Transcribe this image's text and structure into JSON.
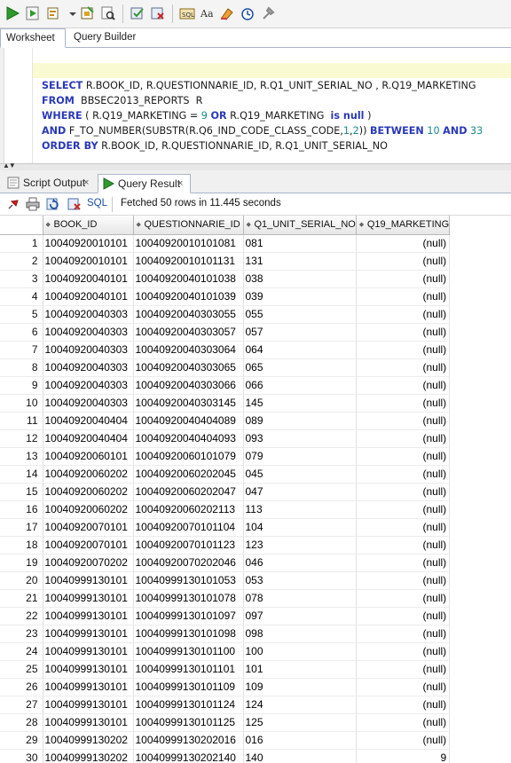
{
  "toolbar": {
    "icons": [
      "run-statement-icon",
      "run-script-icon",
      "explain-plan-icon",
      "dropdown-arrow-icon",
      "autotrace-icon",
      "sql-tuning-icon",
      "commit-icon",
      "rollback-icon",
      "unshared-sql-icon",
      "to-upper-lower-icon",
      "clear-icon",
      "sql-history-icon",
      "format-icon"
    ]
  },
  "editor": {
    "tabs": [
      "Worksheet",
      "Query Builder"
    ],
    "lines": [
      [
        {
          "t": "SELECT",
          "k": "kw"
        },
        {
          "t": " R.BOOK_ID, R.QUESTIONNARIE_ID, R.Q1_UNIT_SERIAL_NO , R.Q19_MARKETING"
        }
      ],
      [
        {
          "t": "FROM",
          "k": "kw"
        },
        {
          "t": "  BBSEC2013_REPORTS  R"
        }
      ],
      [
        {
          "t": "WHERE",
          "k": "kw"
        },
        {
          "t": " ( R.Q19_MARKETING = "
        },
        {
          "t": "9",
          "k": "num"
        },
        {
          "t": " "
        },
        {
          "t": "OR",
          "k": "kw"
        },
        {
          "t": " R.Q19_MARKETING  "
        },
        {
          "t": "is null",
          "k": "kw"
        },
        {
          "t": " )"
        }
      ],
      [
        {
          "t": "AND",
          "k": "kw"
        },
        {
          "t": " F_TO_NUMBER(SUBSTR(R.Q6_IND_CODE_CLASS_CODE,"
        },
        {
          "t": "1",
          "k": "num"
        },
        {
          "t": ","
        },
        {
          "t": "2",
          "k": "num"
        },
        {
          "t": ")) "
        },
        {
          "t": "BETWEEN",
          "k": "kw"
        },
        {
          "t": " "
        },
        {
          "t": "10",
          "k": "num"
        },
        {
          "t": " "
        },
        {
          "t": "AND",
          "k": "kw"
        },
        {
          "t": " "
        },
        {
          "t": "33",
          "k": "num"
        }
      ],
      [
        {
          "t": "ORDER BY",
          "k": "kw"
        },
        {
          "t": " R.BOOK_ID, R.QUESTIONNARIE_ID, R.Q1_UNIT_SERIAL_NO"
        }
      ]
    ]
  },
  "result_tabs": {
    "script_output": "Script Output",
    "query_result": "Query Result",
    "close_glyph": "×"
  },
  "result_toolbar": {
    "sql_label": "SQL",
    "status": "Fetched 50 rows in 11.445 seconds"
  },
  "grid": {
    "columns": [
      "BOOK_ID",
      "QUESTIONNARIE_ID",
      "Q1_UNIT_SERIAL_NO",
      "Q19_MARKETING"
    ],
    "rows": [
      [
        "1",
        "10040920010101",
        "10040920010101081",
        "081",
        "(null)"
      ],
      [
        "2",
        "10040920010101",
        "10040920010101131",
        "131",
        "(null)"
      ],
      [
        "3",
        "10040920040101",
        "10040920040101038",
        "038",
        "(null)"
      ],
      [
        "4",
        "10040920040101",
        "10040920040101039",
        "039",
        "(null)"
      ],
      [
        "5",
        "10040920040303",
        "10040920040303055",
        "055",
        "(null)"
      ],
      [
        "6",
        "10040920040303",
        "10040920040303057",
        "057",
        "(null)"
      ],
      [
        "7",
        "10040920040303",
        "10040920040303064",
        "064",
        "(null)"
      ],
      [
        "8",
        "10040920040303",
        "10040920040303065",
        "065",
        "(null)"
      ],
      [
        "9",
        "10040920040303",
        "10040920040303066",
        "066",
        "(null)"
      ],
      [
        "10",
        "10040920040303",
        "10040920040303145",
        "145",
        "(null)"
      ],
      [
        "11",
        "10040920040404",
        "10040920040404089",
        "089",
        "(null)"
      ],
      [
        "12",
        "10040920040404",
        "10040920040404093",
        "093",
        "(null)"
      ],
      [
        "13",
        "10040920060101",
        "10040920060101079",
        "079",
        "(null)"
      ],
      [
        "14",
        "10040920060202",
        "10040920060202045",
        "045",
        "(null)"
      ],
      [
        "15",
        "10040920060202",
        "10040920060202047",
        "047",
        "(null)"
      ],
      [
        "16",
        "10040920060202",
        "10040920060202113",
        "113",
        "(null)"
      ],
      [
        "17",
        "10040920070101",
        "10040920070101104",
        "104",
        "(null)"
      ],
      [
        "18",
        "10040920070101",
        "10040920070101123",
        "123",
        "(null)"
      ],
      [
        "19",
        "10040920070202",
        "10040920070202046",
        "046",
        "(null)"
      ],
      [
        "20",
        "10040999130101",
        "10040999130101053",
        "053",
        "(null)"
      ],
      [
        "21",
        "10040999130101",
        "10040999130101078",
        "078",
        "(null)"
      ],
      [
        "22",
        "10040999130101",
        "10040999130101097",
        "097",
        "(null)"
      ],
      [
        "23",
        "10040999130101",
        "10040999130101098",
        "098",
        "(null)"
      ],
      [
        "24",
        "10040999130101",
        "10040999130101100",
        "100",
        "(null)"
      ],
      [
        "25",
        "10040999130101",
        "10040999130101101",
        "101",
        "(null)"
      ],
      [
        "26",
        "10040999130101",
        "10040999130101109",
        "109",
        "(null)"
      ],
      [
        "27",
        "10040999130101",
        "10040999130101124",
        "124",
        "(null)"
      ],
      [
        "28",
        "10040999130101",
        "10040999130101125",
        "125",
        "(null)"
      ],
      [
        "29",
        "10040999130202",
        "10040999130202016",
        "016",
        "(null)"
      ],
      [
        "30",
        "10040999130202",
        "10040999130202140",
        "140",
        "9"
      ]
    ]
  }
}
